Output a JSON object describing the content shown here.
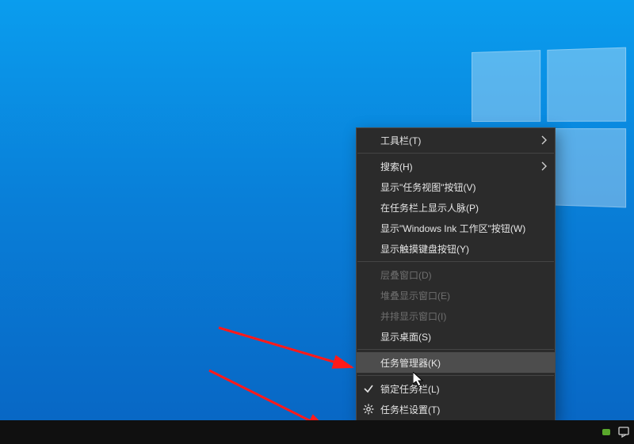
{
  "menu": {
    "items": [
      {
        "label": "工具栏(T)",
        "interact": true,
        "submenu": true
      },
      {
        "sep": true
      },
      {
        "label": "搜索(H)",
        "interact": true,
        "submenu": true
      },
      {
        "label": "显示\"任务视图\"按钮(V)",
        "interact": true
      },
      {
        "label": "在任务栏上显示人脉(P)",
        "interact": true
      },
      {
        "label": "显示\"Windows Ink 工作区\"按钮(W)",
        "interact": true
      },
      {
        "label": "显示触摸键盘按钮(Y)",
        "interact": true
      },
      {
        "sep": true
      },
      {
        "label": "层叠窗口(D)",
        "interact": false,
        "disabled": true
      },
      {
        "label": "堆叠显示窗口(E)",
        "interact": false,
        "disabled": true
      },
      {
        "label": "并排显示窗口(I)",
        "interact": false,
        "disabled": true
      },
      {
        "label": "显示桌面(S)",
        "interact": true
      },
      {
        "sep": true
      },
      {
        "label": "任务管理器(K)",
        "interact": true,
        "hover": true
      },
      {
        "sep": true
      },
      {
        "label": "锁定任务栏(L)",
        "interact": true,
        "lead": "check"
      },
      {
        "label": "任务栏设置(T)",
        "interact": true,
        "lead": "gear"
      }
    ]
  },
  "tray": {
    "icon1": "nvidia-indicator",
    "icon2": "action-center-icon"
  }
}
